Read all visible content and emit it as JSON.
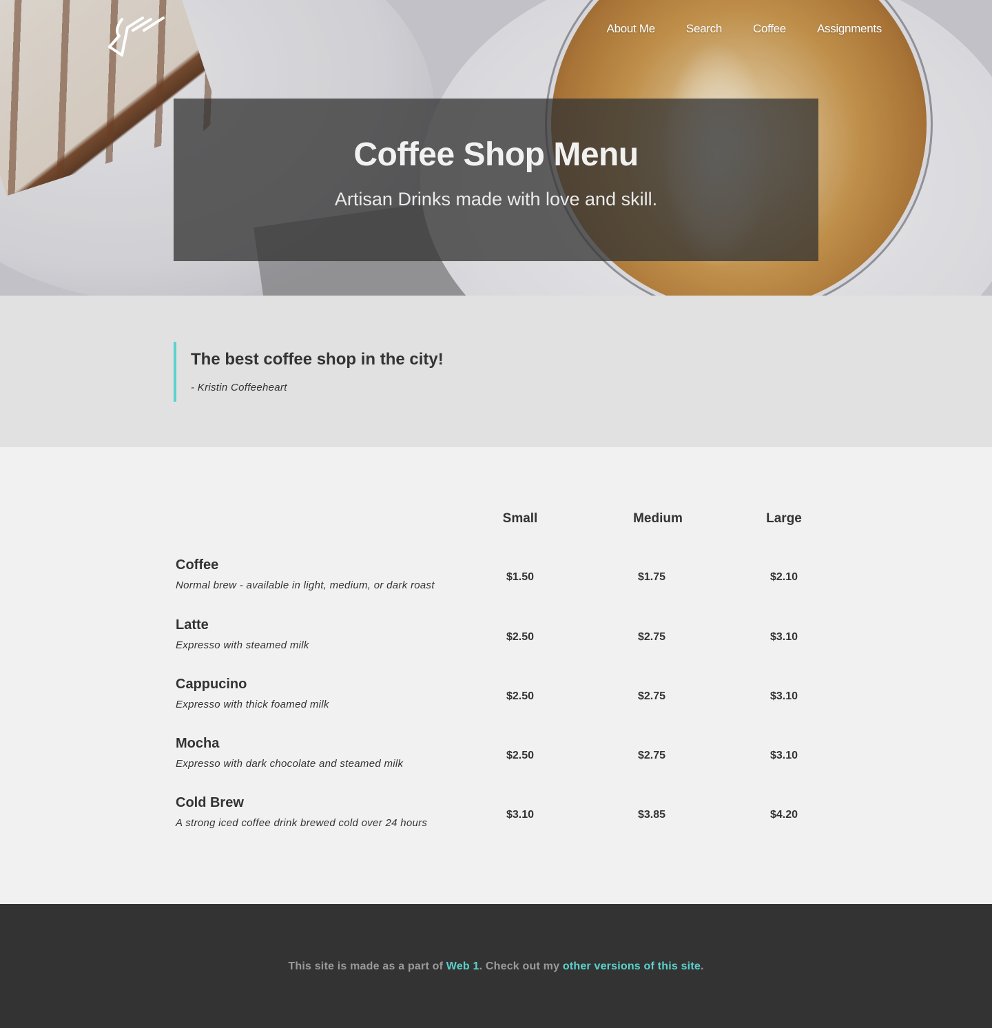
{
  "nav": {
    "items": [
      {
        "label": "About Me"
      },
      {
        "label": "Search"
      },
      {
        "label": "Coffee"
      },
      {
        "label": "Assignments"
      }
    ]
  },
  "hero": {
    "title": "Coffee Shop Menu",
    "subtitle": "Artisan Drinks made with love and skill."
  },
  "quote": {
    "text": "The best coffee shop in the city!",
    "author": "- Kristin Coffeeheart"
  },
  "menu": {
    "columns": [
      "Small",
      "Medium",
      "Large"
    ],
    "items": [
      {
        "name": "Coffee",
        "description": "Normal brew - available in light, medium, or dark roast",
        "prices": [
          "$1.50",
          "$1.75",
          "$2.10"
        ]
      },
      {
        "name": "Latte",
        "description": "Expresso with steamed milk",
        "prices": [
          "$2.50",
          "$2.75",
          "$3.10"
        ]
      },
      {
        "name": "Cappucino",
        "description": "Expresso with thick foamed milk",
        "prices": [
          "$2.50",
          "$2.75",
          "$3.10"
        ]
      },
      {
        "name": "Mocha",
        "description": "Expresso with dark chocolate and steamed milk",
        "prices": [
          "$2.50",
          "$2.75",
          "$3.10"
        ]
      },
      {
        "name": "Cold Brew",
        "description": "A strong iced coffee drink brewed cold over 24 hours",
        "prices": [
          "$3.10",
          "$3.85",
          "$4.20"
        ]
      }
    ]
  },
  "footer": {
    "prefix": "This site is made as a part of ",
    "link1": "Web 1",
    "middle": ". Check out my ",
    "link2": "other versions of this site",
    "suffix": "."
  },
  "colors": {
    "accent": "#5ad2cd",
    "footer_bg": "#333333",
    "quote_bg": "#e1e1e1",
    "page_bg": "#f1f1f1"
  }
}
